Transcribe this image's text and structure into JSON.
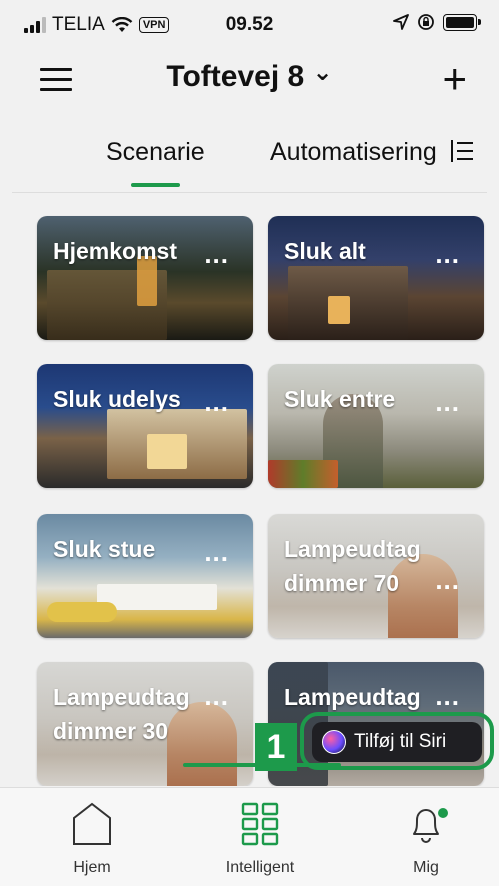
{
  "status_bar": {
    "carrier": "TELIA",
    "vpn": "VPN",
    "time": "09.52"
  },
  "header": {
    "title": "Toftevej 8",
    "title_chevron": "⌄",
    "add_icon": "plus-icon",
    "menu_icon": "hamburger-menu-icon"
  },
  "tabs": [
    {
      "label": "Scenarie",
      "active": true
    },
    {
      "label": "Automatisering",
      "active": false
    }
  ],
  "scenes": [
    {
      "name": "Hjemkomst",
      "dots": "..."
    },
    {
      "name": "Sluk alt",
      "dots": "..."
    },
    {
      "name": "Sluk udelys",
      "dots": "..."
    },
    {
      "name": "Sluk entre",
      "dots": "..."
    },
    {
      "name": "Sluk stue",
      "dots": "..."
    },
    {
      "name": "Lampeudtag dimmer 70",
      "dots": "..."
    },
    {
      "name": "Lampeudtag dimmer 30",
      "dots": "..."
    },
    {
      "name": "Lampeudtag",
      "dots": "..."
    }
  ],
  "siri": {
    "label": "Tilføj til Siri",
    "step": "1"
  },
  "bottom_nav": [
    {
      "label": "Hjem",
      "icon": "home-icon",
      "active": false
    },
    {
      "label": "Intelligent",
      "icon": "grid-icon",
      "active": true
    },
    {
      "label": "Mig",
      "icon": "bell-icon",
      "active": false
    }
  ],
  "colors": {
    "accent": "#1d9a4b",
    "background": "#f1f1f1",
    "siri_button": "#1f1f23"
  }
}
